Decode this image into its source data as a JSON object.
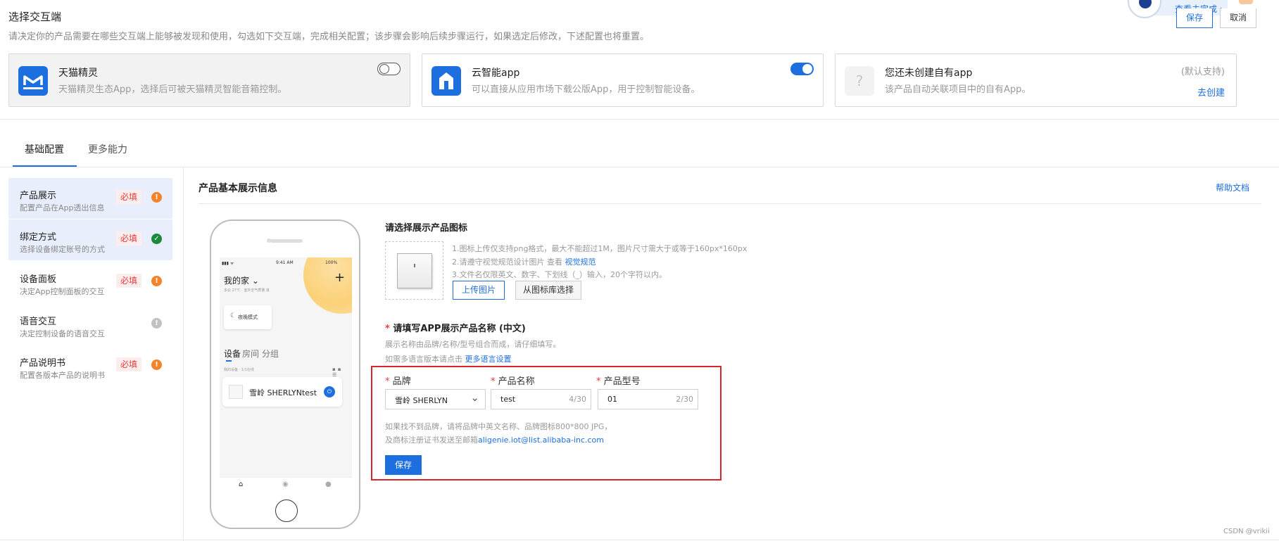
{
  "top": {
    "title": "选择交互端",
    "description": "请决定你的产品需要在哪些交互端上能够被发现和使用，勾选如下交互端，完成相关配置；该步骤会影响后续步骤运行，如果选定后修改，下述配置也将重置。",
    "save_label": "保存",
    "cancel_label": "取消",
    "progress_link": "查看未完成 ›"
  },
  "cards": [
    {
      "title": "天猫精灵",
      "desc": "天猫精灵生态App，选择后可被天猫精灵智能音箱控制。",
      "enabled": false,
      "icon": "tmall-genie-icon"
    },
    {
      "title": "云智能app",
      "desc": "可以直接从应用市场下载公版App，用于控制智能设备。",
      "enabled": true,
      "icon": "cloud-app-icon"
    },
    {
      "title": "您还未创建自有app",
      "desc": "该产品自动关联项目中的自有App。",
      "default_tag": "(默认支持)",
      "create_link": "去创建",
      "icon": "question-icon",
      "icon_glyph": "?"
    }
  ],
  "tabs": [
    {
      "label": "基础配置",
      "active": true
    },
    {
      "label": "更多能力",
      "active": false
    }
  ],
  "menu": [
    {
      "title": "产品展示",
      "desc": "配置产品在App透出信息",
      "tag": "必填",
      "status": "warning",
      "glyph": "!",
      "selected": true
    },
    {
      "title": "绑定方式",
      "desc": "选择设备绑定账号的方式",
      "tag": "必填",
      "status": "ok",
      "glyph": "✓",
      "selected": true
    },
    {
      "title": "设备面板",
      "desc": "决定App控制面板的交互",
      "tag": "必填",
      "status": "warning",
      "glyph": "!",
      "selected": false
    },
    {
      "title": "语音交互",
      "desc": "决定控制设备的语音交互",
      "tag": "",
      "status": "neutral",
      "glyph": "!",
      "selected": false
    },
    {
      "title": "产品说明书",
      "desc": "配置各版本产品的说明书",
      "tag": "必填",
      "status": "warning",
      "glyph": "!",
      "selected": false
    }
  ],
  "main": {
    "title": "产品基本展示信息",
    "help": "帮助文档"
  },
  "phone": {
    "time": "9:41 AM",
    "battery": "100%",
    "home_title": "我的家 ⌄",
    "home_sub": "多云 27℃ · 室外空气质量 良",
    "scene": "夜晚模式",
    "tabs": [
      "设备",
      "房间",
      "分组"
    ],
    "dev_sub": "我的设备 · 1/1在线",
    "device_name": "雪岭 SHERLYNtest"
  },
  "icon_section": {
    "title": "请选择展示产品图标",
    "hint1": "1.图标上传仅支持png格式，最大不能超过1M，图片尺寸需大于或等于160px*160px",
    "hint2_prefix": "2.请遵守视觉规范设计图片 查看 ",
    "hint2_link": "视觉规范",
    "hint3": "3.文件名仅限英文、数字、下划线（_）输入，20个字符以内。",
    "upload_label": "上传图片",
    "library_label": "从图标库选择"
  },
  "name_section": {
    "title": "请填写APP展示产品名称 (中文)",
    "desc": "展示名称由品牌/名称/型号组合而成，请仔细填写。",
    "desc2_prefix": "如需多语言版本请点击 ",
    "desc2_link": "更多语言设置",
    "brand_label": "品牌",
    "brand_value": "雪岭 SHERLYN",
    "name_label": "产品名称",
    "name_value": "test",
    "name_count": "4/30",
    "model_label": "产品型号",
    "model_value": "01",
    "model_count": "2/30",
    "note1": "如果找不到品牌，请将品牌中英文名称、品牌图标800*800 JPG，",
    "note2_prefix": "及商标注册证书发送至邮箱",
    "note2_email": "aligenie.iot@list.alibaba-inc.com",
    "save_label": "保存"
  },
  "watermark": "CSDN @vrikii",
  "colors": {
    "accent": "#1d6fe0",
    "required": "#e23b3b",
    "warning": "#f5832a",
    "ok": "#1c8a3a",
    "highlight": "#d9262c"
  }
}
